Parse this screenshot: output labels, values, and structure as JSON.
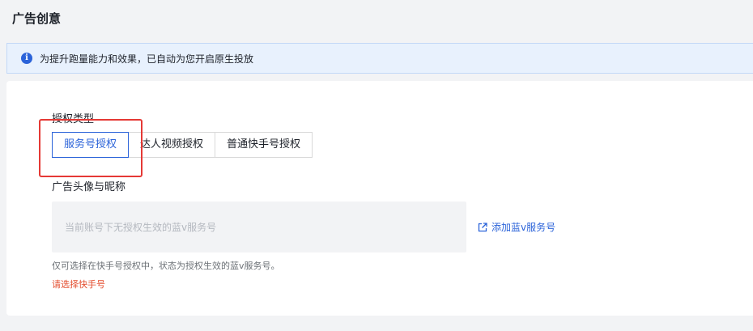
{
  "header": {
    "title": "广告创意"
  },
  "notice": {
    "text": "为提升跑量能力和效果，已自动为您开启原生投放",
    "icon": "info-icon"
  },
  "auth": {
    "label": "授权类型",
    "tabs": [
      {
        "label": "服务号授权",
        "active": true
      },
      {
        "label": "达人视频授权",
        "active": false
      },
      {
        "label": "普通快手号授权",
        "active": false
      }
    ]
  },
  "avatar": {
    "label": "广告头像与昵称",
    "placeholder": "当前账号下无授权生效的蓝v服务号",
    "add_link": "添加蓝v服务号",
    "hint": "仅可选择在快手号授权中，状态为授权生效的蓝v服务号。",
    "error": "请选择快手号"
  },
  "colors": {
    "accent": "#2b63d9",
    "error": "#e34d2e",
    "highlight": "#e53935"
  }
}
